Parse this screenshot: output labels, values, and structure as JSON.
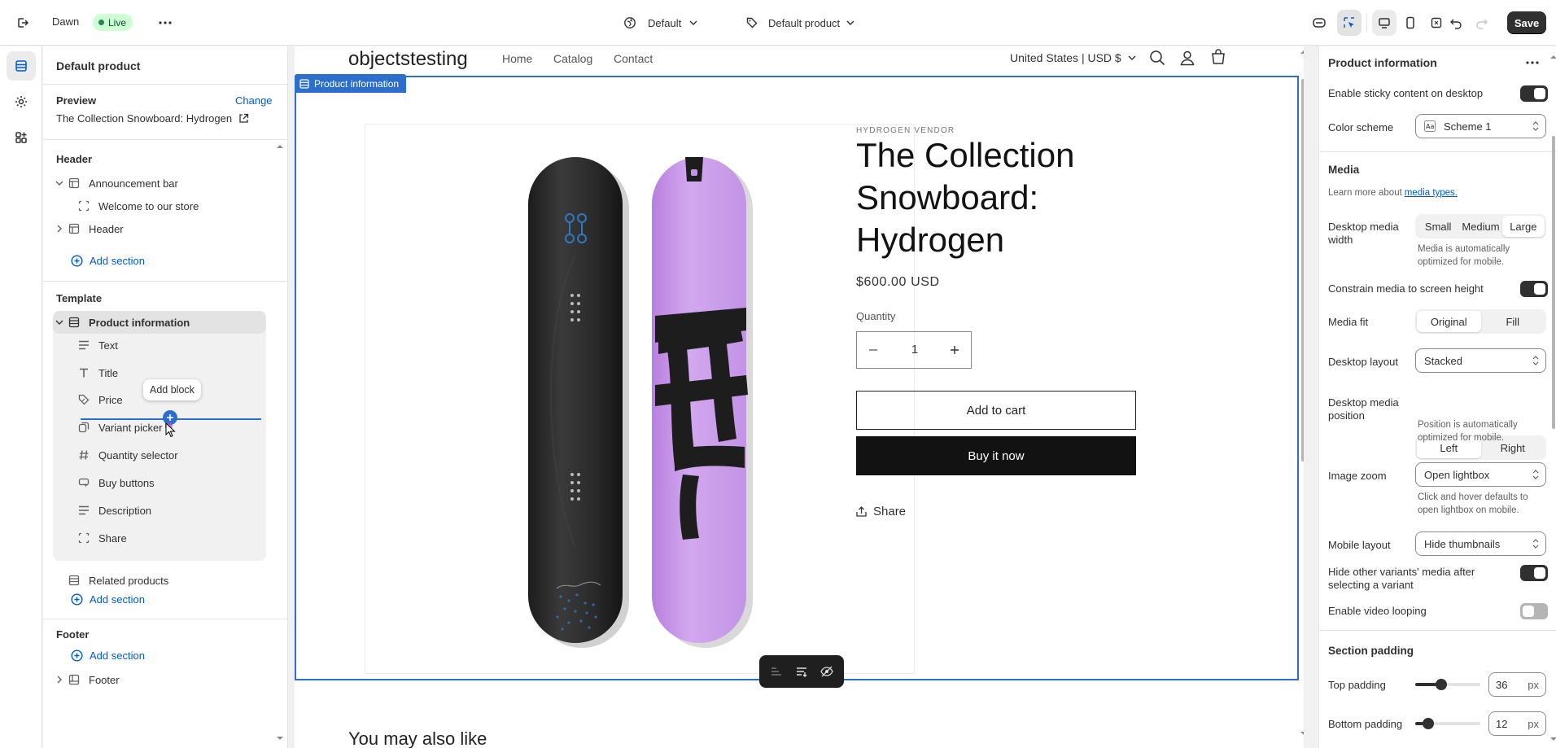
{
  "topbar": {
    "theme_name": "Dawn",
    "live_badge": "Live",
    "template_selector": "Default",
    "product_selector": "Default product",
    "save_label": "Save"
  },
  "left_panel": {
    "title": "Default product",
    "preview_label": "Preview",
    "change_link": "Change",
    "preview_product": "The Collection Snowboard: Hydrogen",
    "header_group": "Header",
    "announcement_bar": "Announcement bar",
    "welcome_block": "Welcome to our store",
    "header_section": "Header",
    "add_section": "Add section",
    "template_group": "Template",
    "product_information": "Product information",
    "blocks": [
      "Text",
      "Title",
      "Price",
      "Variant picker",
      "Quantity selector",
      "Buy buttons",
      "Description",
      "Share"
    ],
    "related_products": "Related products",
    "footer_group": "Footer",
    "footer_section": "Footer",
    "add_block_tooltip": "Add block"
  },
  "preview": {
    "store_name": "objectstesting",
    "nav": [
      "Home",
      "Catalog",
      "Contact"
    ],
    "locale": "United States | USD $",
    "section_tag": "Product information",
    "vendor": "HYDROGEN VENDOR",
    "product_title": "The Collection Snowboard: Hydrogen",
    "price": "$600.00 USD",
    "quantity_label": "Quantity",
    "quantity_value": "1",
    "add_to_cart": "Add to cart",
    "buy_now": "Buy it now",
    "share": "Share",
    "next_section_heading": "You may also like"
  },
  "right_panel": {
    "title": "Product information",
    "sticky_label": "Enable sticky content on desktop",
    "sticky_on": true,
    "color_scheme_label": "Color scheme",
    "color_scheme_value": "Scheme 1",
    "media_heading": "Media",
    "learn_more": "Learn more about",
    "media_types_link": "media types.",
    "desktop_media_width_label": "Desktop media width",
    "media_width_options": [
      "Small",
      "Medium",
      "Large"
    ],
    "media_width_selected": "Large",
    "media_width_help": "Media is automatically optimized for mobile.",
    "constrain_label": "Constrain media to screen height",
    "constrain_on": true,
    "media_fit_label": "Media fit",
    "media_fit_options": [
      "Original",
      "Fill"
    ],
    "media_fit_selected": "Original",
    "desktop_layout_label": "Desktop layout",
    "desktop_layout_value": "Stacked",
    "media_position_label": "Desktop media position",
    "media_position_options": [
      "Left",
      "Right"
    ],
    "media_position_selected": "Left",
    "media_position_help": "Position is automatically optimized for mobile.",
    "image_zoom_label": "Image zoom",
    "image_zoom_value": "Open lightbox",
    "image_zoom_help": "Click and hover defaults to open lightbox on mobile.",
    "mobile_layout_label": "Mobile layout",
    "mobile_layout_value": "Hide thumbnails",
    "hide_variants_label": "Hide other variants' media after selecting a variant",
    "hide_variants_on": true,
    "video_loop_label": "Enable video looping",
    "video_loop_on": false,
    "section_padding_heading": "Section padding",
    "top_padding_label": "Top padding",
    "top_padding_value": "36",
    "bottom_padding_label": "Bottom padding",
    "bottom_padding_value": "12",
    "unit": "px"
  },
  "colors": {
    "accent": "#005bd3",
    "selection": "#2c6ecb",
    "board_dark": "#2b2b2b",
    "board_purple": "#c99be8"
  }
}
